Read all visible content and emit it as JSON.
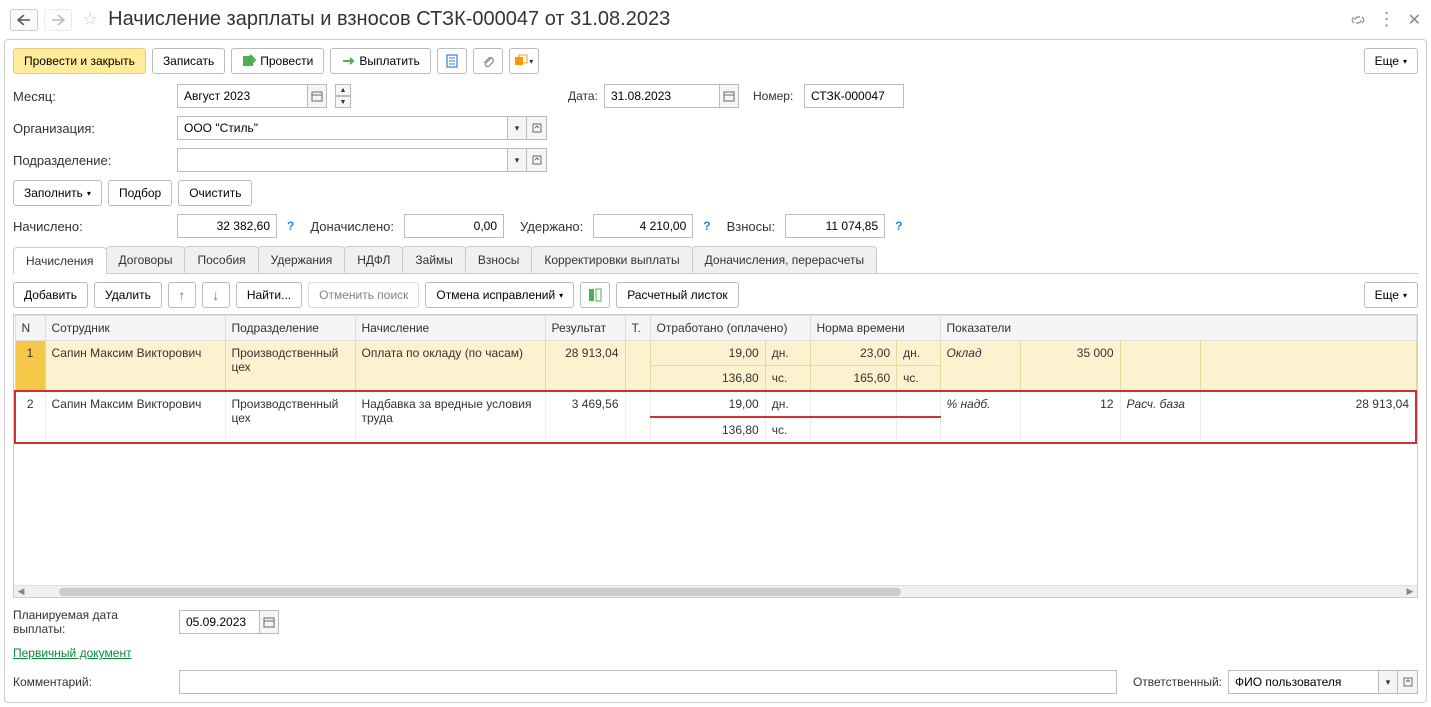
{
  "header": {
    "title": "Начисление зарплаты и взносов СТЗК-000047 от 31.08.2023"
  },
  "toolbar": {
    "post_close": "Провести и закрыть",
    "write": "Записать",
    "post": "Провести",
    "pay": "Выплатить",
    "more": "Еще"
  },
  "form": {
    "month_label": "Месяц:",
    "month_value": "Август 2023",
    "date_label": "Дата:",
    "date_value": "31.08.2023",
    "number_label": "Номер:",
    "number_value": "СТЗК-000047",
    "org_label": "Организация:",
    "org_value": "ООО \"Стиль\"",
    "dept_label": "Подразделение:",
    "dept_value": ""
  },
  "fill_bar": {
    "fill": "Заполнить",
    "pick": "Подбор",
    "clear": "Очистить"
  },
  "summary": {
    "accrued_label": "Начислено:",
    "accrued": "32 382,60",
    "addl_label": "Доначислено:",
    "addl": "0,00",
    "withheld_label": "Удержано:",
    "withheld": "4 210,00",
    "contrib_label": "Взносы:",
    "contrib": "11 074,85"
  },
  "tabs": [
    "Начисления",
    "Договоры",
    "Пособия",
    "Удержания",
    "НДФЛ",
    "Займы",
    "Взносы",
    "Корректировки выплаты",
    "Доначисления, перерасчеты"
  ],
  "sub_toolbar": {
    "add": "Добавить",
    "del": "Удалить",
    "find": "Найти...",
    "cancel_find": "Отменить поиск",
    "cancel_corr": "Отмена исправлений",
    "payslip": "Расчетный листок",
    "more": "Еще"
  },
  "table": {
    "headers": {
      "n": "N",
      "employee": "Сотрудник",
      "dept": "Подразделение",
      "accrual": "Начисление",
      "result": "Результат",
      "t": "Т.",
      "worked": "Отработано (оплачено)",
      "norm": "Норма времени",
      "indicators": "Показатели"
    },
    "rows": [
      {
        "n": "1",
        "employee": "Сапин Максим Викторович",
        "dept": "Производственный цех",
        "accrual": "Оплата по окладу (по часам)",
        "result": "28 913,04",
        "worked_days": "19,00",
        "worked_days_u": "дн.",
        "worked_hours": "136,80",
        "worked_hours_u": "чс.",
        "norm_days": "23,00",
        "norm_days_u": "дн.",
        "norm_hours": "165,60",
        "norm_hours_u": "чс.",
        "ind1_name": "Оклад",
        "ind1_val": "35 000",
        "ind2_name": "",
        "ind2_val": ""
      },
      {
        "n": "2",
        "employee": "Сапин Максим Викторович",
        "dept": "Производственный цех",
        "accrual": "Надбавка за вредные условия труда",
        "result": "3 469,56",
        "worked_days": "19,00",
        "worked_days_u": "дн.",
        "worked_hours": "136,80",
        "worked_hours_u": "чс.",
        "norm_days": "",
        "norm_days_u": "",
        "norm_hours": "",
        "norm_hours_u": "",
        "ind1_name": "% надб.",
        "ind1_val": "12",
        "ind2_name": "Расч. база",
        "ind2_val": "28 913,04"
      }
    ]
  },
  "footer": {
    "plan_date_label": "Планируемая дата выплаты:",
    "plan_date": "05.09.2023",
    "primary_doc": "Первичный документ",
    "comment_label": "Комментарий:",
    "comment": "",
    "responsible_label": "Ответственный:",
    "responsible": "ФИО пользователя"
  }
}
